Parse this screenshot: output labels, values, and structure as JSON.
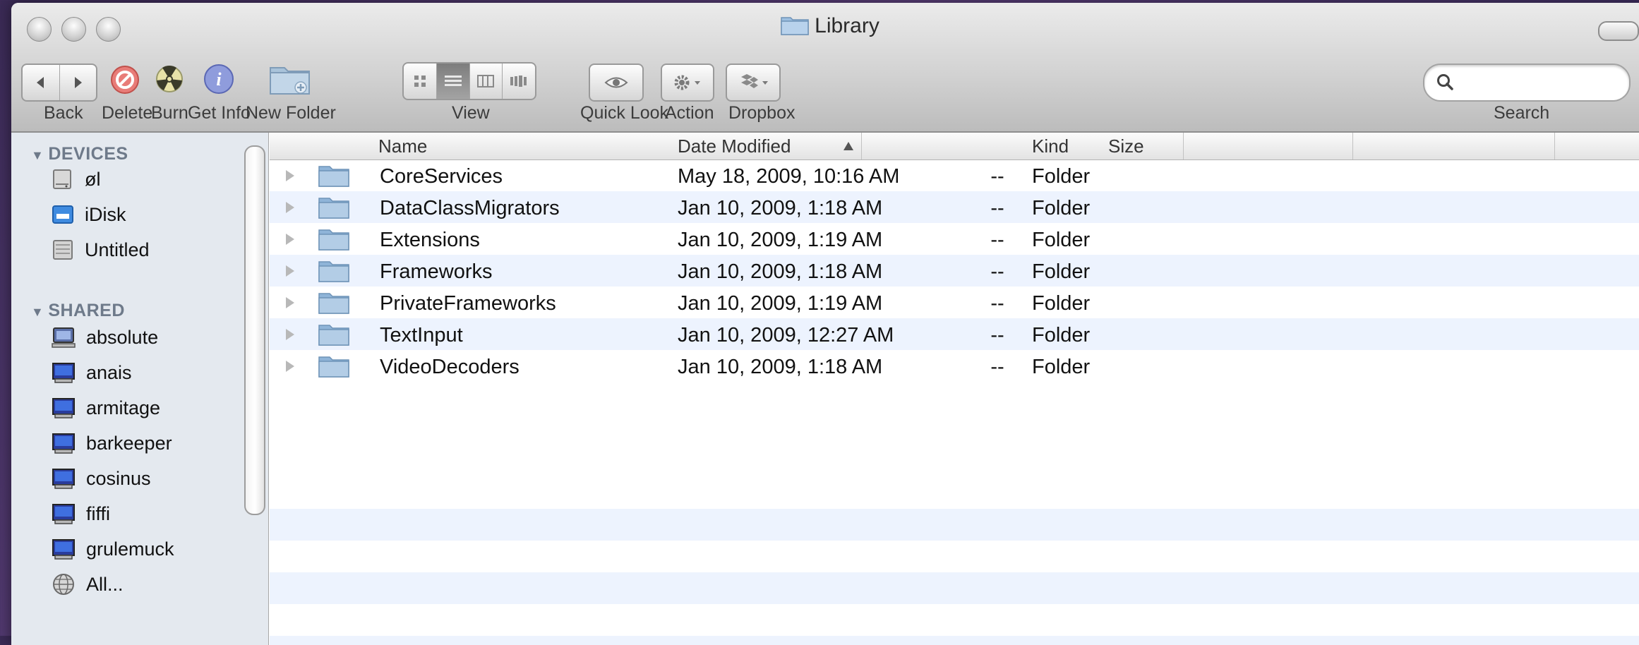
{
  "window": {
    "title": "Library"
  },
  "toolbar": {
    "back_label": "Back",
    "delete_label": "Delete",
    "burn_label": "Burn",
    "get_info_label": "Get Info",
    "new_folder_label": "New Folder",
    "view_label": "View",
    "view_modes": [
      "icon-view",
      "list-view",
      "column-view",
      "cover-flow"
    ],
    "active_view": "list-view",
    "quick_look_label": "Quick Look",
    "action_label": "Action",
    "dropbox_label": "Dropbox",
    "search_label": "Search",
    "search_value": ""
  },
  "sidebar": {
    "devices_label": "DEVICES",
    "devices": [
      {
        "label": "øl",
        "icon": "hard-drive-icon"
      },
      {
        "label": "iDisk",
        "icon": "idisk-icon"
      },
      {
        "label": "Untitled",
        "icon": "hard-drive-icon"
      }
    ],
    "shared_label": "SHARED",
    "shared": [
      {
        "label": "absolute",
        "icon": "computer-icon"
      },
      {
        "label": "anais",
        "icon": "monitor-icon"
      },
      {
        "label": "armitage",
        "icon": "monitor-icon"
      },
      {
        "label": "barkeeper",
        "icon": "monitor-icon"
      },
      {
        "label": "cosinus",
        "icon": "monitor-icon"
      },
      {
        "label": "fiffi",
        "icon": "monitor-icon"
      },
      {
        "label": "grulemuck",
        "icon": "monitor-icon"
      },
      {
        "label": "All...",
        "icon": "network-globe-icon"
      }
    ]
  },
  "list": {
    "columns": {
      "name": "Name",
      "date": "Date Modified",
      "size": "Size",
      "kind": "Kind"
    },
    "sort_column": "Name",
    "rows": [
      {
        "name": "CoreServices",
        "date": "May 18, 2009, 10:16 AM",
        "size": "--",
        "kind": "Folder"
      },
      {
        "name": "DataClassMigrators",
        "date": "Jan 10, 2009, 1:18 AM",
        "size": "--",
        "kind": "Folder"
      },
      {
        "name": "Extensions",
        "date": "Jan 10, 2009, 1:19 AM",
        "size": "--",
        "kind": "Folder"
      },
      {
        "name": "Frameworks",
        "date": "Jan 10, 2009, 1:18 AM",
        "size": "--",
        "kind": "Folder"
      },
      {
        "name": "PrivateFrameworks",
        "date": "Jan 10, 2009, 1:19 AM",
        "size": "--",
        "kind": "Folder"
      },
      {
        "name": "TextInput",
        "date": "Jan 10, 2009, 12:27 AM",
        "size": "--",
        "kind": "Folder"
      },
      {
        "name": "VideoDecoders",
        "date": "Jan 10, 2009, 1:18 AM",
        "size": "--",
        "kind": "Folder"
      }
    ]
  },
  "colors": {
    "sidebar_bg": "#e4e9ef",
    "row_alt": "#edf3fe",
    "folder_blue": "#8fb4d8"
  }
}
